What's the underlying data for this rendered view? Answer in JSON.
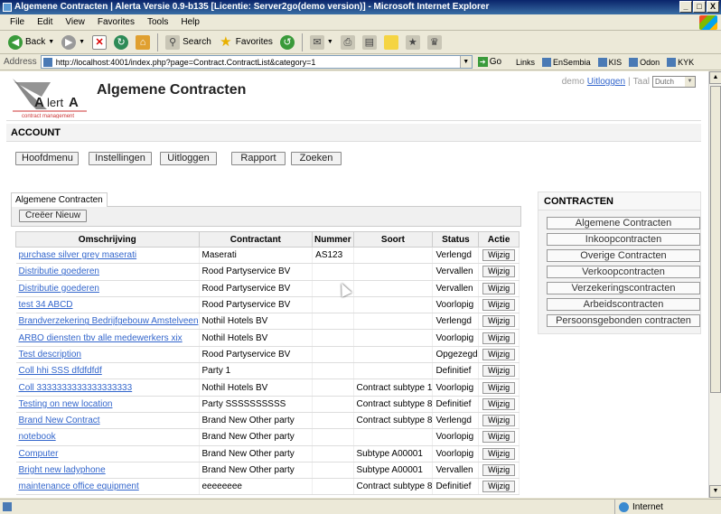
{
  "window": {
    "title": "Algemene Contracten | Alerta Versie 0.9-b135 [Licentie: Server2go(demo version)] - Microsoft Internet Explorer",
    "buttons": [
      "_",
      "□",
      "X"
    ]
  },
  "menubar": [
    "File",
    "Edit",
    "View",
    "Favorites",
    "Tools",
    "Help"
  ],
  "toolbar": {
    "back": "Back",
    "search": "Search",
    "favorites": "Favorites"
  },
  "addressbar": {
    "label": "Address",
    "url": "http://localhost:4001/index.php?page=Contract.ContractList&category=1",
    "go": "Go",
    "links_label": "Links",
    "links": [
      "EnSembia",
      "KIS",
      "Odon",
      "KYK"
    ]
  },
  "page": {
    "logo_text": "AlertA",
    "logo_sub": "contract management",
    "title": "Algemene Contracten",
    "user": "demo",
    "logout": "Uitloggen",
    "lang_label": "Taal",
    "lang_value": "Dutch",
    "section": "ACCOUNT",
    "actions": [
      "Hoofdmenu",
      "Instellingen",
      "Uitloggen",
      "Rapport",
      "Zoeken"
    ],
    "tab": "Algemene Contracten",
    "create_button": "Creëer Nieuw",
    "columns": [
      "Omschrijving",
      "Contractant",
      "Nummer",
      "Soort",
      "Status",
      "Actie"
    ],
    "edit_label": "Wijzig",
    "rows": [
      [
        "purchase silver grey maserati",
        "Maserati",
        "AS123",
        "",
        "Verlengd"
      ],
      [
        "Distributie goederen",
        "Rood Partyservice BV",
        "",
        "",
        "Vervallen"
      ],
      [
        "Distributie goederen",
        "Rood Partyservice BV",
        "",
        "",
        "Vervallen"
      ],
      [
        "test 34 ABCD",
        "Rood Partyservice BV",
        "",
        "",
        "Voorlopig"
      ],
      [
        "Brandverzekering Bedrijfgebouw Amstelveen",
        "Nothil Hotels BV",
        "",
        "",
        "Verlengd"
      ],
      [
        "ARBO diensten tbv alle medewerkers xix",
        "Nothil Hotels BV",
        "",
        "",
        "Voorlopig"
      ],
      [
        "Test description",
        "Rood Partyservice BV",
        "",
        "",
        "Opgezegd"
      ],
      [
        "Coll hhi SSS dfdfdfdf",
        "Party 1",
        "",
        "",
        "Definitief"
      ],
      [
        "Coll 3333333333333333333",
        "Nothil Hotels BV",
        "",
        "Contract subtype 1",
        "Voorlopig"
      ],
      [
        "Testing on new location",
        "Party SSSSSSSSSS",
        "",
        "Contract subtype 8",
        "Definitief"
      ],
      [
        "Brand New Contract",
        "Brand New Other party",
        "",
        "Contract subtype 8",
        "Verlengd"
      ],
      [
        "notebook",
        "Brand New Other party",
        "",
        "",
        "Voorlopig"
      ],
      [
        "Computer",
        "Brand New Other party",
        "",
        "Subtype A00001",
        "Voorlopig"
      ],
      [
        "Bright new ladyphone",
        "Brand New Other party",
        "",
        "Subtype A00001",
        "Vervallen"
      ],
      [
        "maintenance office equipment",
        "eeeeeeee",
        "",
        "Contract subtype 8",
        "Definitief"
      ]
    ],
    "side_title": "CONTRACTEN",
    "side_links": [
      "Algemene Contracten",
      "Inkoopcontracten",
      "Overige Contracten",
      "Verkoopcontracten",
      "Verzekeringscontracten",
      "Arbeidscontracten",
      "Persoonsgebonden contracten"
    ]
  },
  "status": {
    "zone": "Internet"
  }
}
